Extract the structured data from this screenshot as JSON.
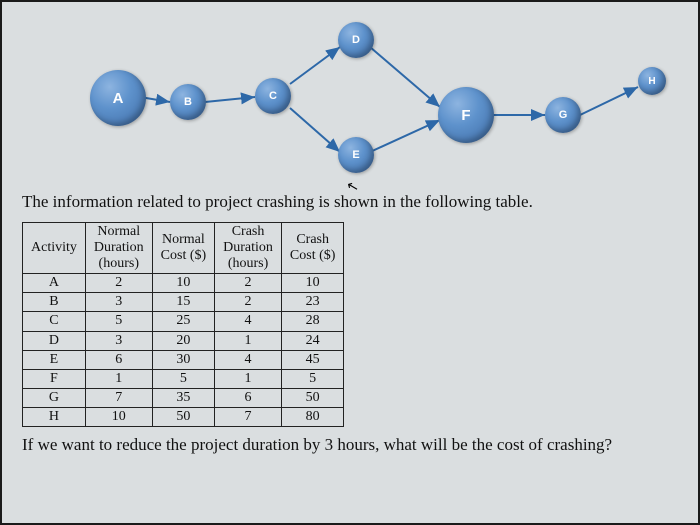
{
  "diagram": {
    "nodes": {
      "A": "A",
      "B": "B",
      "C": "C",
      "D": "D",
      "E": "E",
      "F": "F",
      "G": "G",
      "H": "H"
    }
  },
  "text": {
    "intro": "The information related to project crashing is shown in the following table.",
    "question": "If we want to reduce the project duration by 3 hours, what will be the cost of crashing?"
  },
  "table": {
    "headers": {
      "activity": "Activity",
      "normal_duration": "Normal Duration (hours)",
      "normal_cost": "Normal Cost ($)",
      "crash_duration": "Crash Duration (hours)",
      "crash_cost": "Crash Cost ($)"
    },
    "rows": [
      {
        "activity": "A",
        "nd": "2",
        "nc": "10",
        "cd": "2",
        "cc": "10"
      },
      {
        "activity": "B",
        "nd": "3",
        "nc": "15",
        "cd": "2",
        "cc": "23"
      },
      {
        "activity": "C",
        "nd": "5",
        "nc": "25",
        "cd": "4",
        "cc": "28"
      },
      {
        "activity": "D",
        "nd": "3",
        "nc": "20",
        "cd": "1",
        "cc": "24"
      },
      {
        "activity": "E",
        "nd": "6",
        "nc": "30",
        "cd": "4",
        "cc": "45"
      },
      {
        "activity": "F",
        "nd": "1",
        "nc": "5",
        "cd": "1",
        "cc": "5"
      },
      {
        "activity": "G",
        "nd": "7",
        "nc": "35",
        "cd": "6",
        "cc": "50"
      },
      {
        "activity": "H",
        "nd": "10",
        "nc": "50",
        "cd": "7",
        "cc": "80"
      }
    ]
  }
}
